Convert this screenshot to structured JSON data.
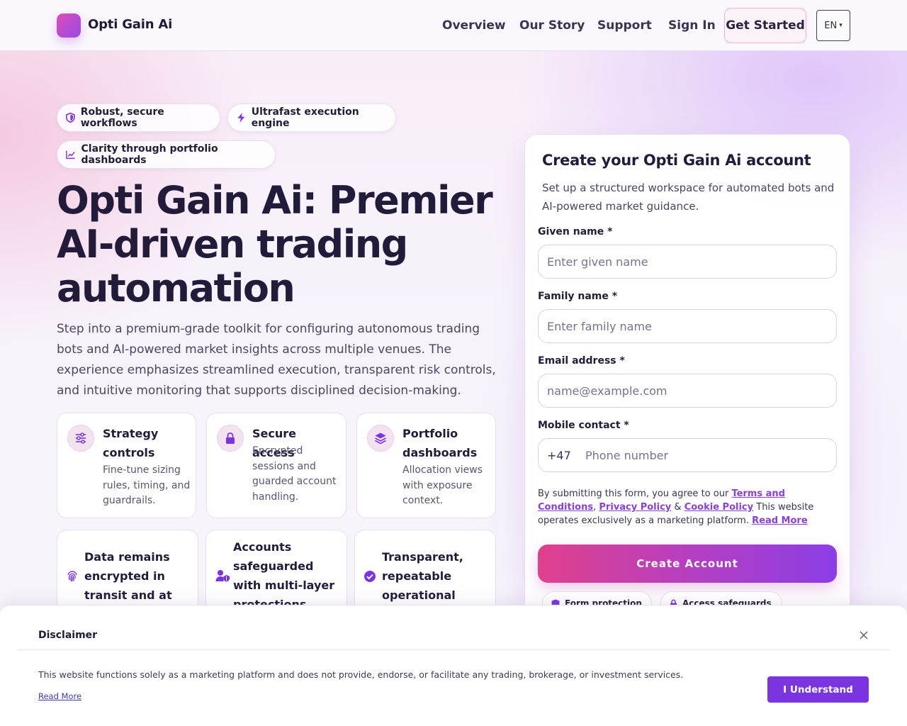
{
  "brand": {
    "name": "Opti Gain Ai"
  },
  "nav": {
    "items": [
      "Overview",
      "Our Story",
      "Support",
      "Sign In"
    ],
    "cta": "Get Started",
    "language": "EN"
  },
  "hero": {
    "pills": [
      {
        "label": "Robust, secure workflows",
        "icon": "shield-icon"
      },
      {
        "label": "Ultrafast execution engine",
        "icon": "lightning-icon"
      },
      {
        "label": "Clarity through portfolio dashboards",
        "icon": "chart-line-icon"
      }
    ],
    "title": "Opti Gain Ai: Premier AI-driven trading automation",
    "description": "Step into a premium-grade toolkit for configuring autonomous trading bots and AI-powered market insights across multiple venues. The experience emphasizes streamlined execution, transparent risk controls, and intuitive monitoring that supports disciplined decision-making."
  },
  "features": [
    {
      "title": "Strategy controls",
      "description": "Fine-tune sizing rules, timing, and guardrails.",
      "icon": "sliders-icon"
    },
    {
      "title": "Secure access",
      "description": "Encrypted sessions and guarded account handling.",
      "icon": "lock-icon"
    },
    {
      "title": "Portfolio dashboards",
      "description": "Allocation views with exposure context.",
      "icon": "layers-icon"
    }
  ],
  "security": [
    {
      "title": "Data remains encrypted in transit and at rest",
      "icon": "fingerprint-icon"
    },
    {
      "title": "Accounts safeguarded with multi-layer protections",
      "icon": "user-shield-icon"
    },
    {
      "title": "Transparent, repeatable operational steps",
      "icon": "check-circle-icon"
    }
  ],
  "form": {
    "title": "Create your Opti Gain Ai account",
    "subtitle": "Set up a structured workspace for automated bots and AI-powered market guidance.",
    "given_name": {
      "label": "Given name *",
      "placeholder": "Enter given name",
      "value": ""
    },
    "family_name": {
      "label": "Family name *",
      "placeholder": "Enter family name",
      "value": ""
    },
    "email": {
      "label": "Email address *",
      "placeholder": "name@example.com",
      "value": ""
    },
    "mobile": {
      "label": "Mobile contact *",
      "prefix": "+47",
      "placeholder": "Phone number",
      "value": ""
    },
    "consent": {
      "prefix": "By submitting this form, you agree to our",
      "terms": "Terms and Conditions",
      "comma": ",",
      "privacy": "Privacy Policy",
      "amp": "&",
      "cookie": "Cookie Policy",
      "middle": "This website operates exclusively as a marketing platform.",
      "read_more": "Read More"
    },
    "submit": "Create Account",
    "badges": [
      {
        "label": "Form protection",
        "icon": "shield-icon"
      },
      {
        "label": "Access safeguards",
        "icon": "lock-icon"
      }
    ]
  },
  "disclaimer": {
    "title": "Disclaimer",
    "text": "This website functions solely as a marketing platform and does not provide, endorse, or facilitate any trading, brokerage, or investment services.",
    "read_more": "Read More",
    "button": "I Understand"
  },
  "colors": {
    "accent": "#7a35e0",
    "brand_gradient_start": "#e0408c",
    "brand_gradient_end": "#8b3ee6",
    "text_dark": "#221b3a"
  }
}
